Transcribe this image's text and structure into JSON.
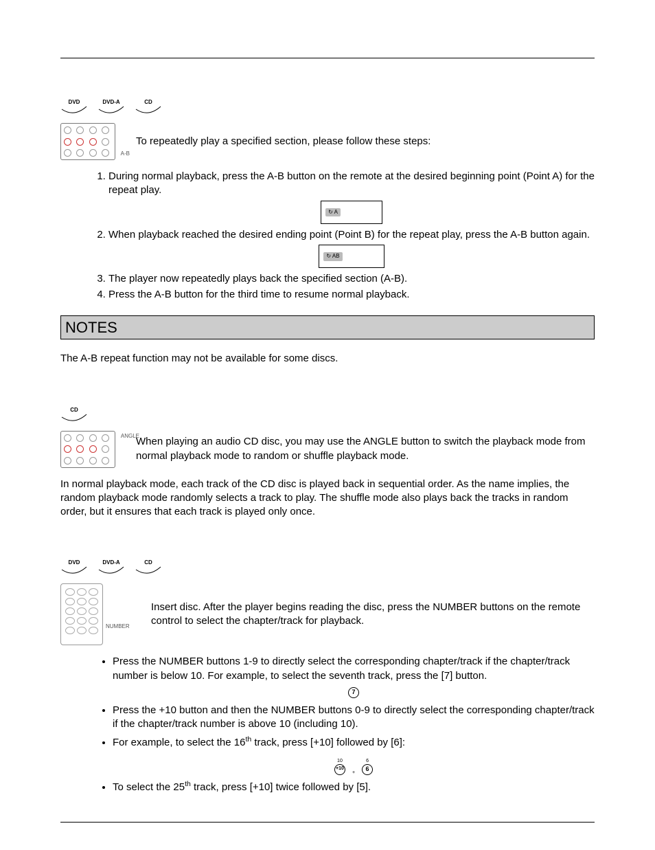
{
  "discs": {
    "dvd": "DVD",
    "dvda": "DVD-A",
    "cd": "CD"
  },
  "remote_labels": {
    "ab": "A-B",
    "angle": "ANGLE",
    "number": "NUMBER"
  },
  "section1": {
    "intro": "To repeatedly play a specified section, please follow these steps:",
    "items": [
      "During normal playback, press the A-B button on the remote at the desired beginning point (Point A) for the repeat play.",
      "When playback reached the desired ending point (Point B) for the repeat play, press the A-B button again.",
      "The player now repeatedly plays back the specified section (A-B).",
      "Press the A-B button for the third time to resume normal playback."
    ],
    "osd_a": "↻ A",
    "osd_ab": "↻ AB"
  },
  "notes": {
    "heading": "NOTES",
    "text": "The A-B repeat function may not be available for some discs."
  },
  "section2": {
    "intro": "When playing an audio CD disc, you may use the ANGLE button to switch the playback mode from normal playback mode to random or shuffle playback mode.",
    "para": "In normal playback mode, each track of the CD disc is played back in sequential order.  As the name implies, the random playback mode randomly selects a track to play.  The shuffle mode also plays back the tracks in random order, but it ensures that each track is played only once."
  },
  "section3": {
    "intro": "Insert disc.  After the player begins reading the disc, press the NUMBER buttons on the remote control to select the chapter/track for playback.",
    "bullets": {
      "b1": "Press the NUMBER buttons 1-9 to directly select the corresponding chapter/track if the chapter/track number is below 10.  For example, to select the seventh track, press the [7] button.",
      "b2": "Press the +10 button and then the NUMBER buttons 0-9 to directly select the corresponding chapter/track if the chapter/track number is above 10 (including 10).",
      "b3a": "For example, to select the 16",
      "b3b": " track, press [+10] followed by [6]:",
      "b4a": "To select the 25",
      "b4b": " track, press [+10] twice followed by [5]."
    },
    "icons": {
      "seven": "7",
      "plus10_label": "10",
      "plus10": "+10",
      "plus": "+",
      "six_label": "6",
      "six": "6"
    },
    "sup": "th"
  }
}
